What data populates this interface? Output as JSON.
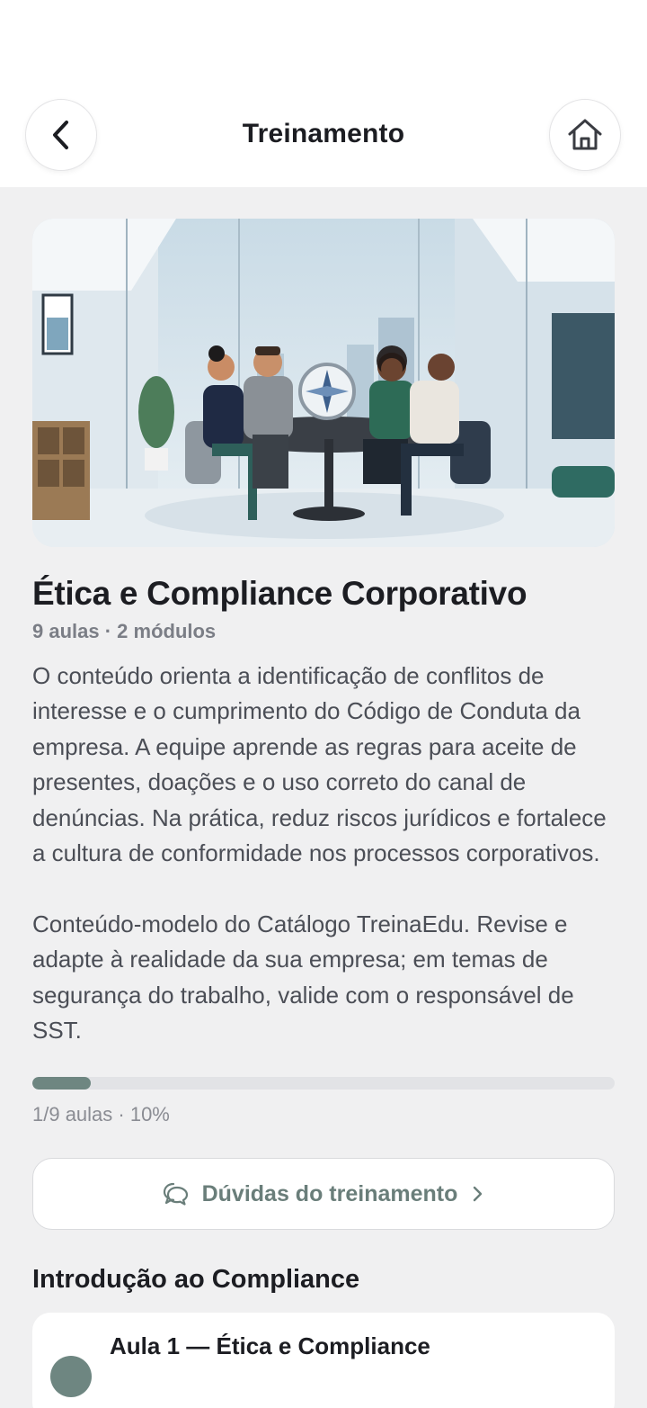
{
  "nav": {
    "title": "Treinamento",
    "back_icon": "chevron-left-icon",
    "home_icon": "home-icon"
  },
  "course": {
    "title": "Ética e Compliance Corporativo",
    "meta": "9 aulas · 2 módulos",
    "description": "O conteúdo orienta a identificação de conflitos de interesse e o cumprimento do Código de Conduta da empresa. A equipe aprende as regras para aceite de presentes, doações e o uso correto do canal de denúncias. Na prática, reduz riscos jurídicos e fortalece a cultura de conformidade nos processos corporativos.\n\nConteúdo-modelo do Catálogo TreinaEdu. Revise e adapte à realidade da sua empresa; em temas de segurança do trabalho, valide com o responsável de SST.",
    "progress_fraction": 0.1,
    "progress_label": "1/9 aulas · 10%"
  },
  "questions_button": {
    "label": "Dúvidas do treinamento",
    "icon": "chat-bubbles-icon"
  },
  "module": {
    "title": "Introdução ao Compliance",
    "lessons": [
      {
        "title": "Aula 1 — Ética e Compliance"
      }
    ]
  },
  "colors": {
    "accent": "#6e8681",
    "background": "#f0f0f1",
    "text": "#1c1d22"
  }
}
